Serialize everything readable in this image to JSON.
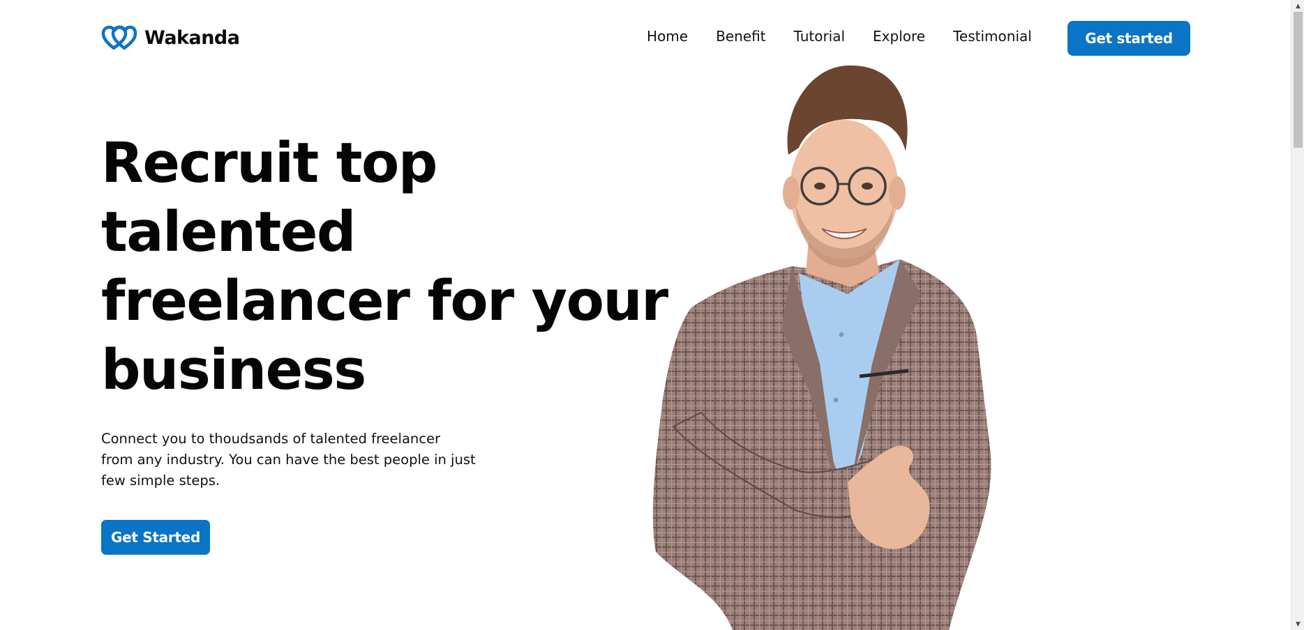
{
  "brand": {
    "name": "Wakanda",
    "logo_icon": "double-heart-logo",
    "accent_color": "#0a74c7"
  },
  "nav": {
    "items": [
      {
        "label": "Home"
      },
      {
        "label": "Benefit"
      },
      {
        "label": "Tutorial"
      },
      {
        "label": "Explore"
      },
      {
        "label": "Testimonial"
      }
    ],
    "cta_label": "Get started"
  },
  "hero": {
    "title_lines": [
      "Recruit top",
      "talented",
      "freelancer for your",
      "business"
    ],
    "description_lines": [
      "Connect you to thoudsands of talented freelancer",
      "from any industry. You can have the best people in just",
      "few simple steps."
    ],
    "cta_label": "Get Started",
    "image": "smiling-man-in-plaid-blazer-photo"
  },
  "scrollbar": {
    "up_icon": "scroll-up-arrow-icon",
    "down_icon": "scroll-down-arrow-icon"
  }
}
